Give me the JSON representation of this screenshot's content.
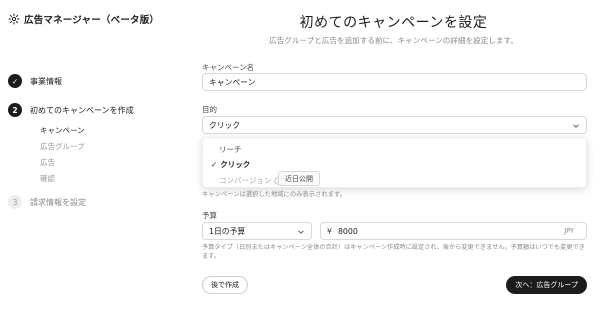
{
  "app": {
    "title": "広告マネージャー（ベータ版）"
  },
  "steps": [
    {
      "number": "✓",
      "label": "事業情報"
    },
    {
      "number": "2",
      "label": "初めてのキャンペーンを作成"
    },
    {
      "number": "3",
      "label": "請求情報を設定"
    }
  ],
  "substeps": [
    "キャンペーン",
    "広告グループ",
    "広告",
    "確認"
  ],
  "page": {
    "title": "初めてのキャンペーンを設定",
    "subtitle": "広告グループと広告を追加する前に、キャンペーンの詳細を設定します。"
  },
  "campaign_name": {
    "label": "キャンペーン名",
    "value": "キャンペーン"
  },
  "objective": {
    "label": "目的",
    "value": "クリック",
    "options": [
      {
        "label": "リーチ"
      },
      {
        "label": "クリック"
      },
      {
        "label": "コンバージョン"
      }
    ],
    "coming_soon_badge": "近日公開"
  },
  "geo_note": "キャンペーンは選択した地域にのみ表示されます。",
  "budget": {
    "label": "予算",
    "type_value": "1日の予算",
    "currency_symbol": "¥",
    "amount": "8000",
    "currency_code": "JPY",
    "note": "予算タイプ（日別またはキャンペーン全体の合計）はキャンペーン作成時に設定され、後から変更できません。予算額はいつでも変更できます。"
  },
  "buttons": {
    "later": "後で作成",
    "next": "次へ：広告グループ"
  }
}
